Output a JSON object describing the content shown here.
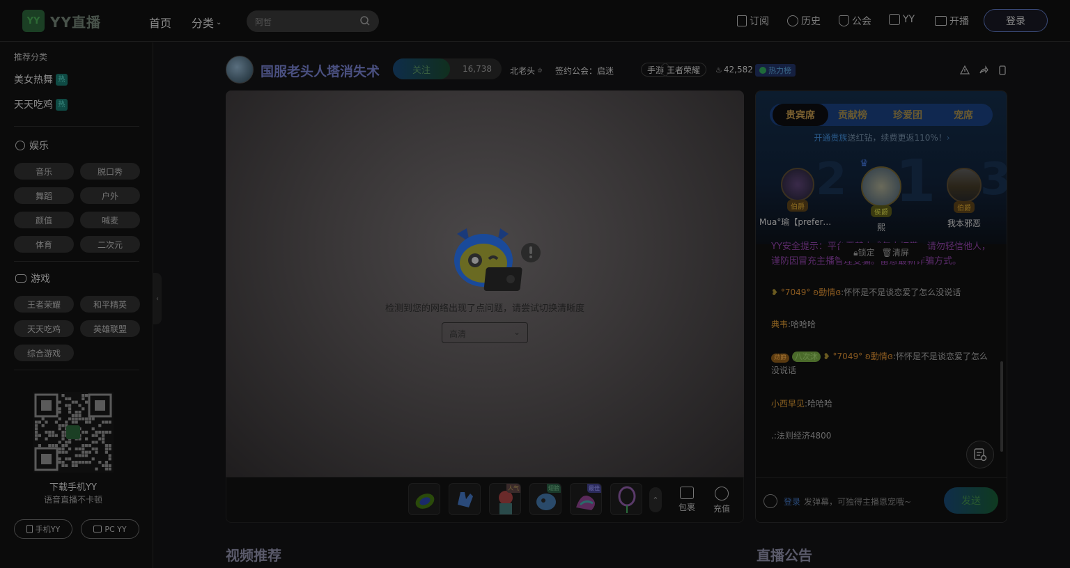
{
  "header": {
    "logo_icon": "YY",
    "logo_text": "YY直播",
    "nav": [
      "首页",
      "分类"
    ],
    "search_placeholder": "阿哲",
    "links": [
      "订阅",
      "历史",
      "公会",
      "YY",
      "开播"
    ],
    "login": "登录"
  },
  "sidebar": {
    "recommend_title": "推荐分类",
    "hot_items": [
      {
        "label": "美女热舞",
        "badge": "热"
      },
      {
        "label": "天天吃鸡",
        "badge": "热"
      }
    ],
    "entertainment": {
      "title": "娱乐",
      "chips": [
        "音乐",
        "脱口秀",
        "舞蹈",
        "户外",
        "颜值",
        "喊麦",
        "体育",
        "二次元"
      ]
    },
    "games": {
      "title": "游戏",
      "chips": [
        "王者荣耀",
        "和平精英",
        "天天吃鸡",
        "英雄联盟",
        "综合游戏"
      ]
    },
    "download_title": "下载手机YY",
    "download_sub": "语音直播不卡顿",
    "buttons": [
      "手机YY",
      "PC YY"
    ]
  },
  "room": {
    "title": "国服老头人塔消失术",
    "follow": "关注",
    "fans": "16,738",
    "host": "北老头",
    "guild": "签约公会：启迷",
    "tags": [
      "手游",
      "王者荣耀"
    ],
    "heat": "42,582",
    "heat_rank": "热力榜"
  },
  "player": {
    "error": "检测到您的网络出现了点问题，请尝试切换清晰度",
    "quality": "高清",
    "gift_badges": [
      "",
      "",
      "人气",
      "翅膀",
      "最佳",
      ""
    ],
    "tools": [
      "包裹",
      "充值"
    ]
  },
  "panel": {
    "tabs": [
      "贵宾席",
      "贡献榜",
      "珍爱团",
      "宠席"
    ],
    "promo_prefix": "开通贵族",
    "promo_text": "送红钻，续费更返110%！",
    "seats": [
      {
        "rank": "2",
        "name": "Mua°瑜【prefere…",
        "badge": "伯爵"
      },
      {
        "rank": "1",
        "name": "熙",
        "badge": "侯爵"
      },
      {
        "rank": "3",
        "name": "我本邪恶",
        "badge": "伯爵"
      }
    ],
    "lock": "锁定",
    "clear": "清屏",
    "system_notice": "YY安全提示：平台严禁未成年人打赏，请勿轻信他人，谨防因冒充主播管理受骗。留意最新诈骗方式。",
    "messages": [
      {
        "user": "°7049° ʚ動情ɞ",
        "text": ":怀怀是不是谈恋爱了怎么没说话"
      },
      {
        "user": "典韦",
        "text": ":哈哈哈"
      },
      {
        "level": "勋爵",
        "medal": "八次沐",
        "user": "°7049° ʚ動情ɞ",
        "text": ":怀怀是不是谈恋爱了怎么没说话"
      },
      {
        "user": "小西早见",
        "text": ":哈哈哈"
      },
      {
        "user": ".",
        "text": ":法则经济4800"
      }
    ],
    "input_login": "登录",
    "input_placeholder": "发弹幕，可独得主播恩宠哦~",
    "send": "发送"
  },
  "sections": [
    "视频推荐",
    "直播公告"
  ],
  "colors": {
    "accent_blue": "#3a4a78",
    "hot_badge": "#0f4a44",
    "vip_gold": "#8a6a20"
  }
}
